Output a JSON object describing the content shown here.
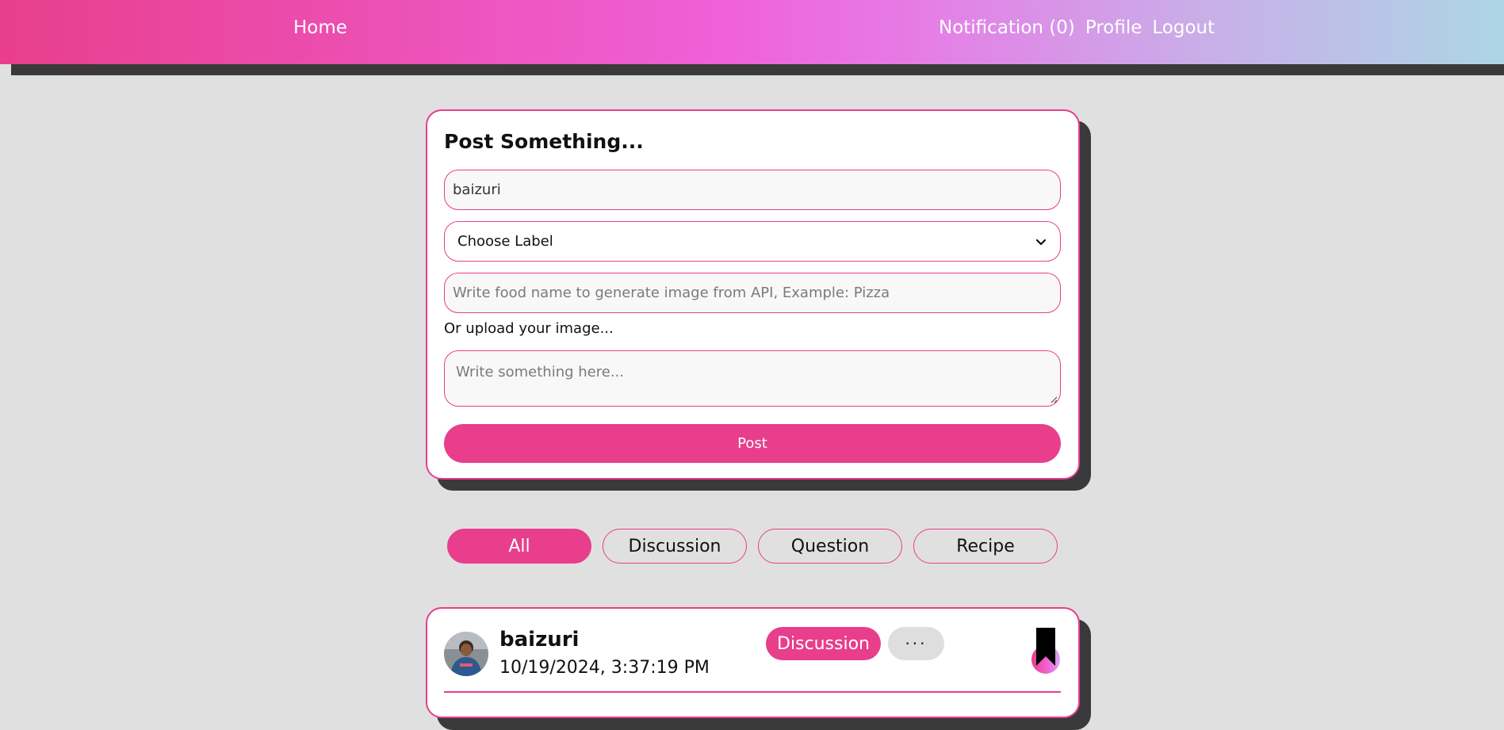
{
  "navbar": {
    "home": "Home",
    "notification": "Notification (0)",
    "profile": "Profile",
    "logout": "Logout"
  },
  "post_form": {
    "title": "Post Something...",
    "name_value": "baizuri",
    "label_select": {
      "selected": "Choose Label"
    },
    "food_input": {
      "placeholder": "Write food name to generate image from API, Example: Pizza"
    },
    "upload_label": "Or upload your image...",
    "content_input": {
      "placeholder": "Write something here..."
    },
    "post_button": "Post"
  },
  "filters": {
    "active": "All",
    "tabs": [
      {
        "label": "All"
      },
      {
        "label": "Discussion"
      },
      {
        "label": "Question"
      },
      {
        "label": "Recipe"
      }
    ]
  },
  "post": {
    "author": "baizuri",
    "date": "10/19/2024, 3:37:19 PM",
    "label": "Discussion",
    "more": "···",
    "bookmarked": true
  },
  "colors": {
    "accent": "#e83e8c",
    "background": "#e0e0e0",
    "shadow": "#3a3a3a"
  },
  "icons": {
    "select": "chevron-down-icon",
    "bookmark": "bookmark-icon",
    "avatar": "user-avatar",
    "textarea": "resize-handle-icon"
  }
}
